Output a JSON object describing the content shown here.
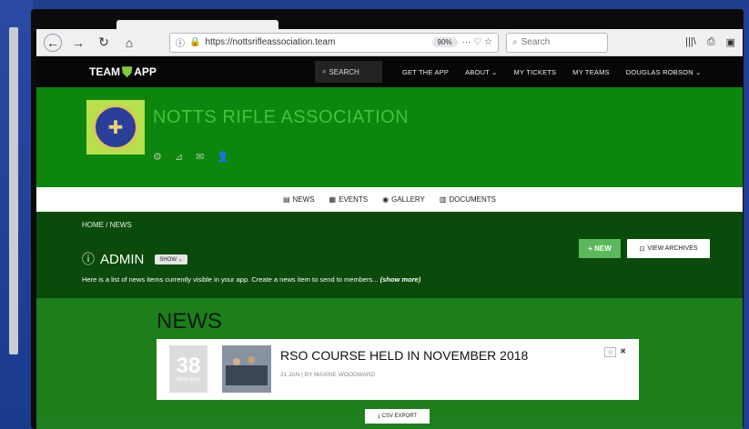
{
  "browser": {
    "url": "https://nottsrifleassociation.team",
    "zoom": "90%",
    "url_tools": "··· ♡ ☆",
    "search_placeholder": "Search"
  },
  "site_nav": {
    "logo_left": "TEAM",
    "logo_right": "APP",
    "search_label": "SEARCH",
    "links": [
      "GET THE APP",
      "ABOUT ⌄",
      "MY TICKETS",
      "MY TEAMS",
      "DOUGLAS ROBSON ⌄"
    ]
  },
  "club": {
    "name": "NOTTS RIFLE ASSOCIATION"
  },
  "tabs": [
    "NEWS",
    "EVENTS",
    "GALLERY",
    "DOCUMENTS"
  ],
  "admin": {
    "breadcrumb": "HOME / NEWS",
    "title": "ADMIN",
    "show_label": "SHOW ⌄",
    "description": "Here is a list of news items currently visible in your app. Create a news item to send to members...",
    "show_more": "(show more)",
    "new_button": "+ NEW",
    "archives_button": "VIEW ARCHIVES"
  },
  "news": {
    "heading": "NEWS",
    "items": [
      {
        "days": "38",
        "ago": "DAYS AGO",
        "title": "RSO COURSE HELD IN NOVEMBER 2018",
        "meta": "21 JAN | BY MAXINE WOODWARD"
      }
    ],
    "csv_button": "CSV EXPORT"
  },
  "colors": {
    "club_green": "#0d860d",
    "admin_dark": "#0a4a0a",
    "new_button": "#5bb85b"
  }
}
